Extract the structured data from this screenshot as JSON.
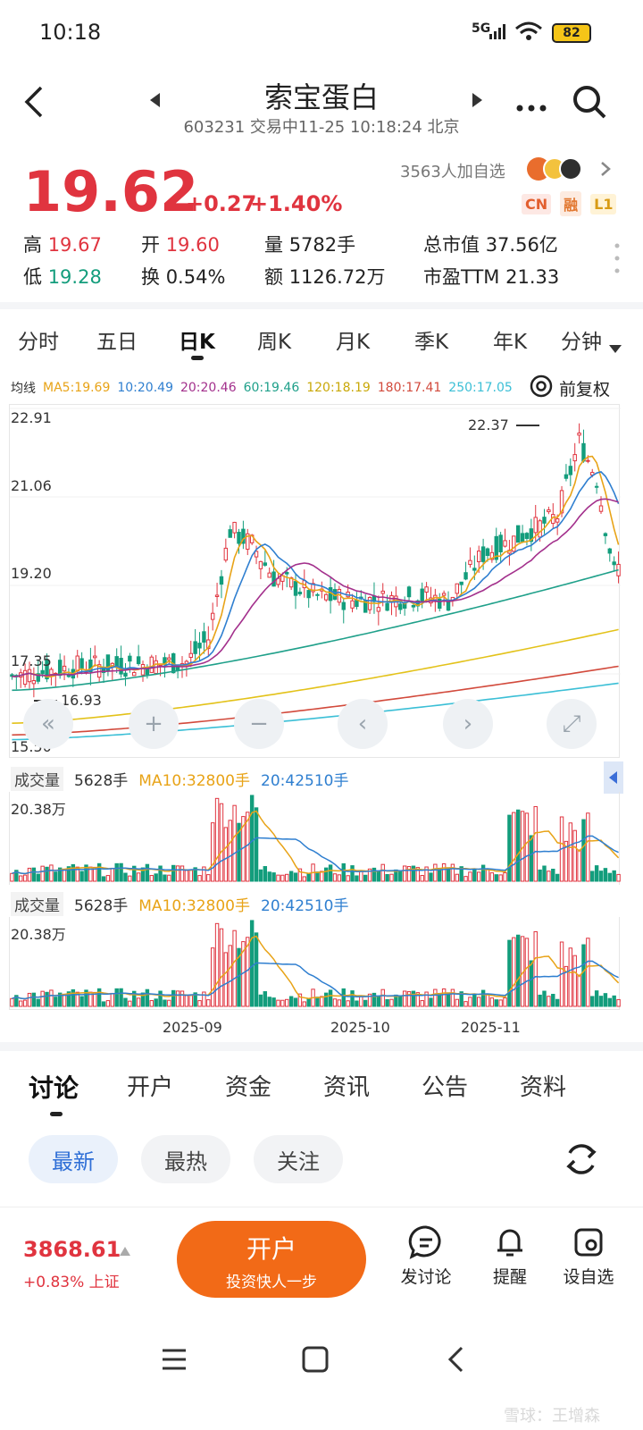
{
  "status_bar": {
    "time": "10:18",
    "network": "5G",
    "battery": "82"
  },
  "header": {
    "title": "索宝蛋白",
    "subtitle": "603231 交易中11-25 10:18:24 北京"
  },
  "quote": {
    "price": "19.62",
    "change": "+0.27",
    "change_pct": "+1.40%",
    "followers": "3563人加自选",
    "badges": [
      "CN",
      "融",
      "L1"
    ],
    "stats": [
      {
        "label": "高",
        "value": "19.67",
        "color": "red"
      },
      {
        "label": "开",
        "value": "19.60",
        "color": "red"
      },
      {
        "label": "量",
        "value": "5782手",
        "color": "dark"
      },
      {
        "label": "总市值",
        "value": "37.56亿",
        "color": "dark"
      },
      {
        "label": "低",
        "value": "19.28",
        "color": "green"
      },
      {
        "label": "换",
        "value": "0.54%",
        "color": "dark"
      },
      {
        "label": "额",
        "value": "1126.72万",
        "color": "dark"
      },
      {
        "label": "市盈TTM",
        "value": "21.33",
        "color": "dark"
      }
    ]
  },
  "period_tabs": [
    "分时",
    "五日",
    "日K",
    "周K",
    "月K",
    "季K",
    "年K",
    "分钟"
  ],
  "active_period": "日K",
  "ma_legend": {
    "label": "均线",
    "items": [
      {
        "text": "MA5:19.69",
        "color": "#e8a317"
      },
      {
        "text": "10:20.49",
        "color": "#2f7fd0"
      },
      {
        "text": "20:20.46",
        "color": "#a3308c"
      },
      {
        "text": "60:19.46",
        "color": "#1fa08a"
      },
      {
        "text": "120:18.19",
        "color": "#e3c21a"
      },
      {
        "text": "180:17.41",
        "color": "#d24a3c"
      },
      {
        "text": "250:17.05",
        "color": "#3bbfd6"
      }
    ],
    "adjust": "前复权"
  },
  "price_axis": [
    "22.91",
    "21.06",
    "19.20",
    "17.35",
    "15.50"
  ],
  "annotations": {
    "high": "22.37",
    "low": "16.93"
  },
  "volume_panels": [
    {
      "label": "成交量",
      "current": "5628手",
      "ma10": "MA10:32800手",
      "ma20": "20:42510手",
      "max": "20.38万"
    },
    {
      "label": "成交量",
      "current": "5628手",
      "ma10": "MA10:32800手",
      "ma20": "20:42510手",
      "max": "20.38万"
    }
  ],
  "date_axis": [
    "2025-09",
    "2025-10",
    "2025-11"
  ],
  "content_tabs": [
    "讨论",
    "开户",
    "资金",
    "资讯",
    "公告",
    "资料"
  ],
  "filters": [
    "最新",
    "最热",
    "关注"
  ],
  "bottom": {
    "index_value": "3868.61",
    "index_change": "+0.83% 上证",
    "cta_title": "开户",
    "cta_sub": "投资快人一步",
    "actions": [
      "发讨论",
      "提醒",
      "设自选"
    ]
  },
  "watermark": "雪球：王增森"
}
